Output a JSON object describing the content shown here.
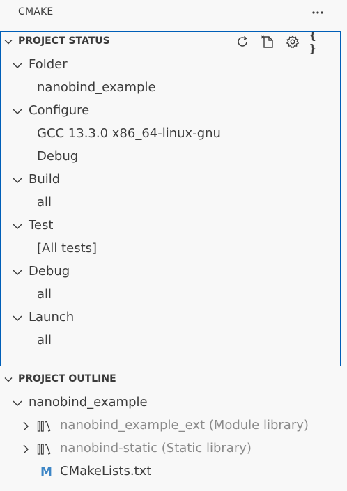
{
  "view": {
    "title": "CMAKE",
    "more_label": "⋯"
  },
  "project_status": {
    "title": "PROJECT STATUS",
    "actions": [
      "refresh-icon",
      "delete-cache-icon",
      "settings-icon",
      "edit-json-icon"
    ],
    "json_label": "{ }",
    "items": [
      {
        "label": "Folder",
        "expanded": true,
        "children": [
          "nanobind_example"
        ]
      },
      {
        "label": "Configure",
        "expanded": true,
        "children": [
          "GCC 13.3.0 x86_64-linux-gnu",
          "Debug"
        ]
      },
      {
        "label": "Build",
        "expanded": true,
        "children": [
          "all"
        ]
      },
      {
        "label": "Test",
        "expanded": true,
        "children": [
          "[All tests]"
        ]
      },
      {
        "label": "Debug",
        "expanded": true,
        "children": [
          "all"
        ]
      },
      {
        "label": "Launch",
        "expanded": true,
        "children": [
          "all"
        ]
      }
    ]
  },
  "project_outline": {
    "title": "PROJECT OUTLINE",
    "root": "nanobind_example",
    "targets": [
      {
        "label": "nanobind_example_ext (Module library)",
        "icon": "library-icon"
      },
      {
        "label": "nanobind-static (Static library)",
        "icon": "library-icon"
      }
    ],
    "file": {
      "label": "CMakeLists.txt",
      "icon_glyph": "M"
    }
  },
  "colors": {
    "focus_border": "#005fb8",
    "cmake_icon": "#3d86c6",
    "muted_text": "#8a8a8a"
  }
}
